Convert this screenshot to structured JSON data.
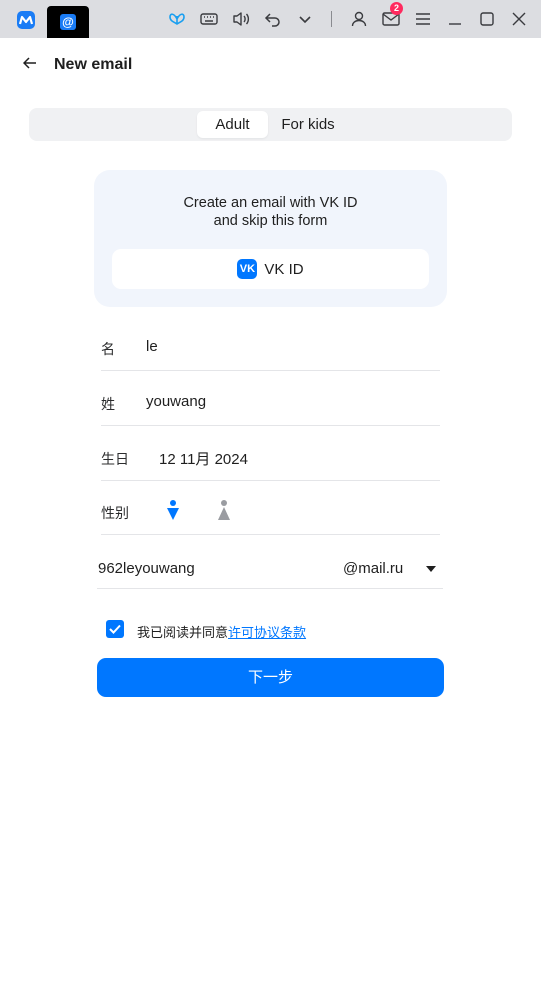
{
  "titlebar": {
    "app_icon": "mail-ru-logo-icon",
    "tab_icon": "at-sign-icon",
    "tab_symbol": "@",
    "mail_badge_count": "2",
    "icons": [
      "butterfly-icon",
      "keyboard-icon",
      "volume-icon",
      "undo-icon",
      "chevron-down-icon",
      "user-icon",
      "mail-icon",
      "menu-icon",
      "minimize-icon",
      "maximize-icon",
      "close-icon"
    ]
  },
  "header": {
    "title": "New email"
  },
  "segmented": {
    "active_label": "Adult",
    "other_label": "For kids"
  },
  "vk_card": {
    "line1": "Create an email with VK ID",
    "line2": "and skip this form",
    "button_label": "VK ID",
    "logo_text": "VK"
  },
  "form": {
    "first_name_label": "名",
    "first_name_value": "le",
    "last_name_label": "姓",
    "last_name_value": "youwang",
    "birthday_label": "生日",
    "birthday_value": "12 11月 2024",
    "gender_label": "性别",
    "email_local": "962leyouwang",
    "email_domain": "@mail.ru"
  },
  "agreement": {
    "checked": true,
    "text": "我已阅读并同意",
    "link": "许可协议条款"
  },
  "next_button": "下一步",
  "colors": {
    "accent": "#0077ff",
    "titlebar": "#dcdde1",
    "card_bg": "#f1f5fc",
    "segment_bg": "#f0f1f3",
    "badge": "#ff2a5f"
  }
}
